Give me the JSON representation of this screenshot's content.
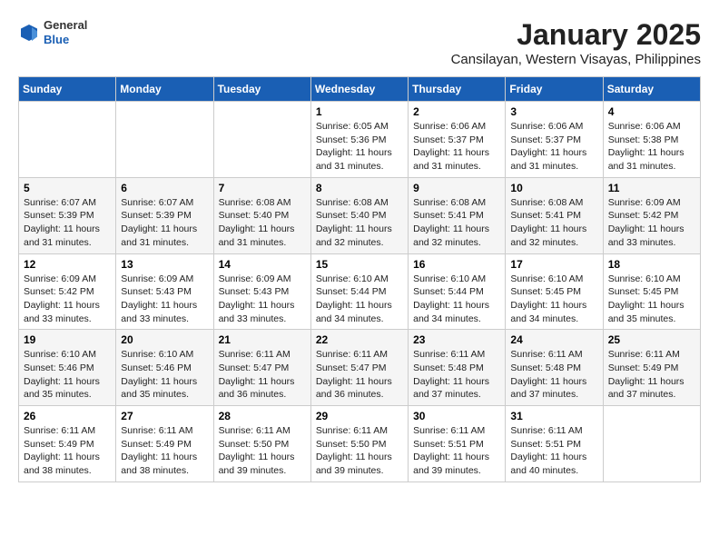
{
  "logo": {
    "general": "General",
    "blue": "Blue"
  },
  "title": "January 2025",
  "subtitle": "Cansilayan, Western Visayas, Philippines",
  "days_of_week": [
    "Sunday",
    "Monday",
    "Tuesday",
    "Wednesday",
    "Thursday",
    "Friday",
    "Saturday"
  ],
  "weeks": [
    [
      {
        "day": "",
        "info": ""
      },
      {
        "day": "",
        "info": ""
      },
      {
        "day": "",
        "info": ""
      },
      {
        "day": "1",
        "sunrise": "6:05 AM",
        "sunset": "5:36 PM",
        "daylight": "11 hours and 31 minutes."
      },
      {
        "day": "2",
        "sunrise": "6:06 AM",
        "sunset": "5:37 PM",
        "daylight": "11 hours and 31 minutes."
      },
      {
        "day": "3",
        "sunrise": "6:06 AM",
        "sunset": "5:37 PM",
        "daylight": "11 hours and 31 minutes."
      },
      {
        "day": "4",
        "sunrise": "6:06 AM",
        "sunset": "5:38 PM",
        "daylight": "11 hours and 31 minutes."
      }
    ],
    [
      {
        "day": "5",
        "sunrise": "6:07 AM",
        "sunset": "5:39 PM",
        "daylight": "11 hours and 31 minutes."
      },
      {
        "day": "6",
        "sunrise": "6:07 AM",
        "sunset": "5:39 PM",
        "daylight": "11 hours and 31 minutes."
      },
      {
        "day": "7",
        "sunrise": "6:08 AM",
        "sunset": "5:40 PM",
        "daylight": "11 hours and 31 minutes."
      },
      {
        "day": "8",
        "sunrise": "6:08 AM",
        "sunset": "5:40 PM",
        "daylight": "11 hours and 32 minutes."
      },
      {
        "day": "9",
        "sunrise": "6:08 AM",
        "sunset": "5:41 PM",
        "daylight": "11 hours and 32 minutes."
      },
      {
        "day": "10",
        "sunrise": "6:08 AM",
        "sunset": "5:41 PM",
        "daylight": "11 hours and 32 minutes."
      },
      {
        "day": "11",
        "sunrise": "6:09 AM",
        "sunset": "5:42 PM",
        "daylight": "11 hours and 33 minutes."
      }
    ],
    [
      {
        "day": "12",
        "sunrise": "6:09 AM",
        "sunset": "5:42 PM",
        "daylight": "11 hours and 33 minutes."
      },
      {
        "day": "13",
        "sunrise": "6:09 AM",
        "sunset": "5:43 PM",
        "daylight": "11 hours and 33 minutes."
      },
      {
        "day": "14",
        "sunrise": "6:09 AM",
        "sunset": "5:43 PM",
        "daylight": "11 hours and 33 minutes."
      },
      {
        "day": "15",
        "sunrise": "6:10 AM",
        "sunset": "5:44 PM",
        "daylight": "11 hours and 34 minutes."
      },
      {
        "day": "16",
        "sunrise": "6:10 AM",
        "sunset": "5:44 PM",
        "daylight": "11 hours and 34 minutes."
      },
      {
        "day": "17",
        "sunrise": "6:10 AM",
        "sunset": "5:45 PM",
        "daylight": "11 hours and 34 minutes."
      },
      {
        "day": "18",
        "sunrise": "6:10 AM",
        "sunset": "5:45 PM",
        "daylight": "11 hours and 35 minutes."
      }
    ],
    [
      {
        "day": "19",
        "sunrise": "6:10 AM",
        "sunset": "5:46 PM",
        "daylight": "11 hours and 35 minutes."
      },
      {
        "day": "20",
        "sunrise": "6:10 AM",
        "sunset": "5:46 PM",
        "daylight": "11 hours and 35 minutes."
      },
      {
        "day": "21",
        "sunrise": "6:11 AM",
        "sunset": "5:47 PM",
        "daylight": "11 hours and 36 minutes."
      },
      {
        "day": "22",
        "sunrise": "6:11 AM",
        "sunset": "5:47 PM",
        "daylight": "11 hours and 36 minutes."
      },
      {
        "day": "23",
        "sunrise": "6:11 AM",
        "sunset": "5:48 PM",
        "daylight": "11 hours and 37 minutes."
      },
      {
        "day": "24",
        "sunrise": "6:11 AM",
        "sunset": "5:48 PM",
        "daylight": "11 hours and 37 minutes."
      },
      {
        "day": "25",
        "sunrise": "6:11 AM",
        "sunset": "5:49 PM",
        "daylight": "11 hours and 37 minutes."
      }
    ],
    [
      {
        "day": "26",
        "sunrise": "6:11 AM",
        "sunset": "5:49 PM",
        "daylight": "11 hours and 38 minutes."
      },
      {
        "day": "27",
        "sunrise": "6:11 AM",
        "sunset": "5:49 PM",
        "daylight": "11 hours and 38 minutes."
      },
      {
        "day": "28",
        "sunrise": "6:11 AM",
        "sunset": "5:50 PM",
        "daylight": "11 hours and 39 minutes."
      },
      {
        "day": "29",
        "sunrise": "6:11 AM",
        "sunset": "5:50 PM",
        "daylight": "11 hours and 39 minutes."
      },
      {
        "day": "30",
        "sunrise": "6:11 AM",
        "sunset": "5:51 PM",
        "daylight": "11 hours and 39 minutes."
      },
      {
        "day": "31",
        "sunrise": "6:11 AM",
        "sunset": "5:51 PM",
        "daylight": "11 hours and 40 minutes."
      },
      {
        "day": "",
        "info": ""
      }
    ]
  ],
  "labels": {
    "sunrise_prefix": "Sunrise: ",
    "sunset_prefix": "Sunset: ",
    "daylight_prefix": "Daylight: "
  }
}
